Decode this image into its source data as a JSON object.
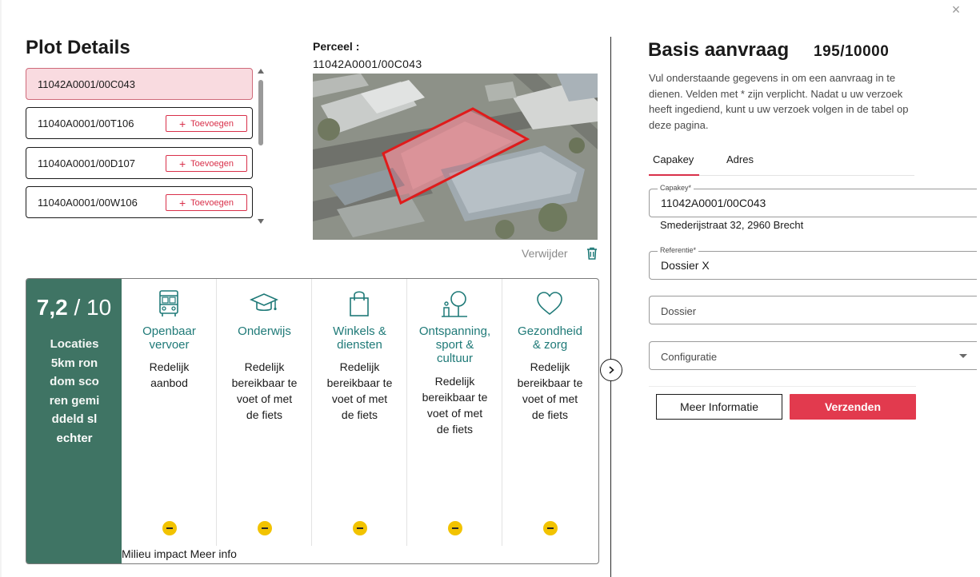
{
  "dialog": {
    "close_label": "×"
  },
  "left": {
    "title": "Plot Details",
    "plots": [
      {
        "id": "11042A0001/00C043",
        "selected": true,
        "add_label": ""
      },
      {
        "id": "11040A0001/00T106",
        "selected": false,
        "add_label": "Toevoegen"
      },
      {
        "id": "11040A0001/00D107",
        "selected": false,
        "add_label": "Toevoegen"
      },
      {
        "id": "11040A0001/00W106",
        "selected": false,
        "add_label": "Toevoegen"
      }
    ],
    "perceel_label": "Perceel :",
    "perceel_id": "11042A0001/00C043",
    "delete_label": "Verwijder",
    "score": {
      "value": "7,2",
      "slash_total": "/ 10",
      "description": "Locaties 5km rondom scoren gemiddeld",
      "description_strong": "slechter"
    },
    "categories": [
      {
        "icon": "bus-icon",
        "title": "Openbaar vervoer",
        "desc": "Redelijk aanbod"
      },
      {
        "icon": "graduation-cap-icon",
        "title": "Onderwijs",
        "desc": "Redelijk bereikbaar te voet of met de fiets"
      },
      {
        "icon": "shopping-bag-icon",
        "title": "Winkels & diensten",
        "desc": "Redelijk bereikbaar te voet of met de fiets"
      },
      {
        "icon": "park-icon",
        "title": "Ontspanning, sport & cultuur",
        "desc": "Redelijk bereikbaar te voet of met de fiets"
      },
      {
        "icon": "heart-icon",
        "title": "Gezondheid & zorg",
        "desc": "Redelijk bereikbaar te voet of met de fiets"
      }
    ],
    "milieu_label": "Milieu impact Meer info"
  },
  "right": {
    "title": "Basis aanvraag",
    "count": "195/10000",
    "intro": "Vul onderstaande gegevens in om een aanvraag in te dienen. Velden met * zijn verplicht. Nadat u uw verzoek heeft ingediend, kunt u uw verzoek volgen in de tabel op deze pagina.",
    "tabs": [
      "Capakey",
      "Adres"
    ],
    "capakey_label": "Capakey*",
    "capakey_value": "11042A0001/00C043",
    "address": "Smederijstraat 32, 2960 Brecht",
    "referentie_label": "Referentie*",
    "referentie_value": "Dossier X",
    "dossier_placeholder": "Dossier",
    "configuratie_placeholder": "Configuratie",
    "btn_info": "Meer Informatie",
    "btn_send": "Verzenden"
  },
  "colors": {
    "accent_red": "#e23a4e",
    "score_green": "#3f7464",
    "category_teal": "#1f7a78",
    "indicator_yellow": "#f2c300"
  }
}
